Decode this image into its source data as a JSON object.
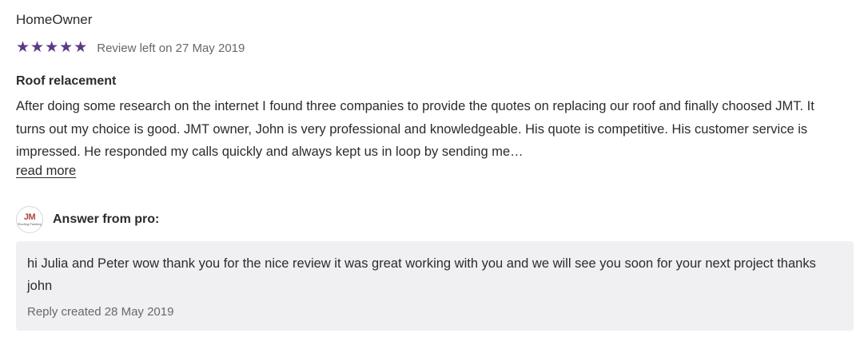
{
  "review": {
    "author": "HomeOwner",
    "rating": 5,
    "date_text": "Review left on 27 May 2019",
    "title": "Roof relacement",
    "body": "After doing some research on the internet I found three companies to provide the quotes on replacing our roof and finally choosed JMT. It turns out my choice is good. JMT owner, John is very professional and knowledgeable. His quote is competitive. His customer service is impressed. He responded my calls quickly and always kept us in loop by sending me…",
    "read_more_label": "read more"
  },
  "answer": {
    "logo_text": "JM",
    "logo_subtext": "Roofing Painting",
    "label": "Answer from pro:",
    "text": "hi Julia and Peter wow thank you for the nice review it was great working with you and we will see you soon for your next project thanks john",
    "date_text": "Reply created 28 May 2019"
  },
  "colors": {
    "star": "#5b3a86",
    "reply_bg": "#f0f0f3"
  }
}
